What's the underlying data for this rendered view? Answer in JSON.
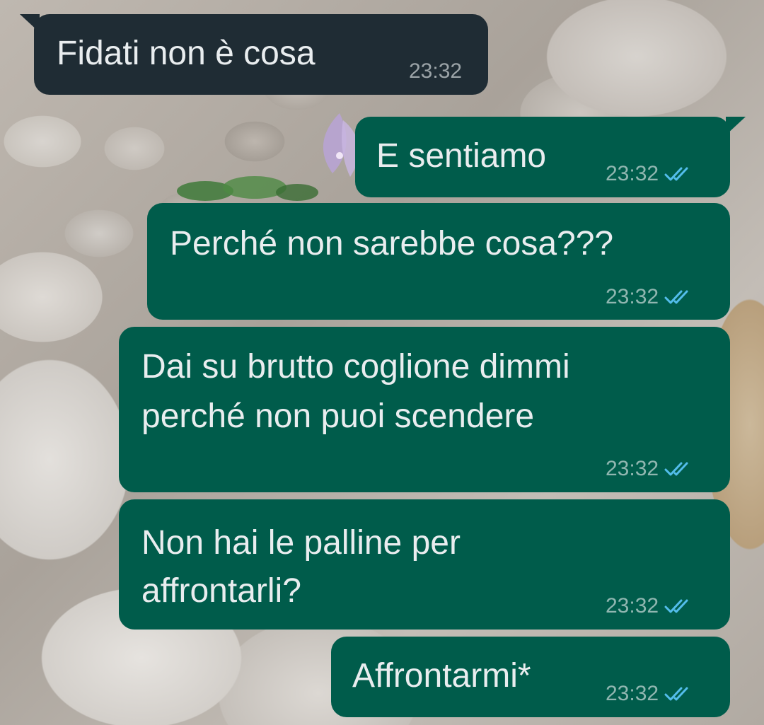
{
  "messages": [
    {
      "id": "m1",
      "direction": "incoming",
      "lines": [
        "Fidati non è cosa"
      ],
      "time": "23:32",
      "ticks": ""
    },
    {
      "id": "m2",
      "direction": "outgoing",
      "lines": [
        "E sentiamo"
      ],
      "time": "23:32",
      "ticks": "read-double-check-icon"
    },
    {
      "id": "m3",
      "direction": "outgoing",
      "lines": [
        "Perché non sarebbe cosa???"
      ],
      "time": "23:32",
      "ticks": "read-double-check-icon"
    },
    {
      "id": "m4",
      "direction": "outgoing",
      "lines": [
        "Dai su brutto coglione dimmi",
        "perché non puoi scendere"
      ],
      "time": "23:32",
      "ticks": "read-double-check-icon"
    },
    {
      "id": "m5",
      "direction": "outgoing",
      "lines": [
        "Non hai le palline per",
        "affrontarli?"
      ],
      "time": "23:32",
      "ticks": "read-double-check-icon"
    },
    {
      "id": "m6",
      "direction": "outgoing",
      "lines": [
        "Affrontarmi*"
      ],
      "time": "23:32",
      "ticks": "read-double-check-icon"
    }
  ],
  "colors": {
    "incoming_bubble": "#1f2c34",
    "outgoing_bubble": "#005c4b",
    "text": "#e9edef",
    "read_ticks": "#53bdeb"
  }
}
